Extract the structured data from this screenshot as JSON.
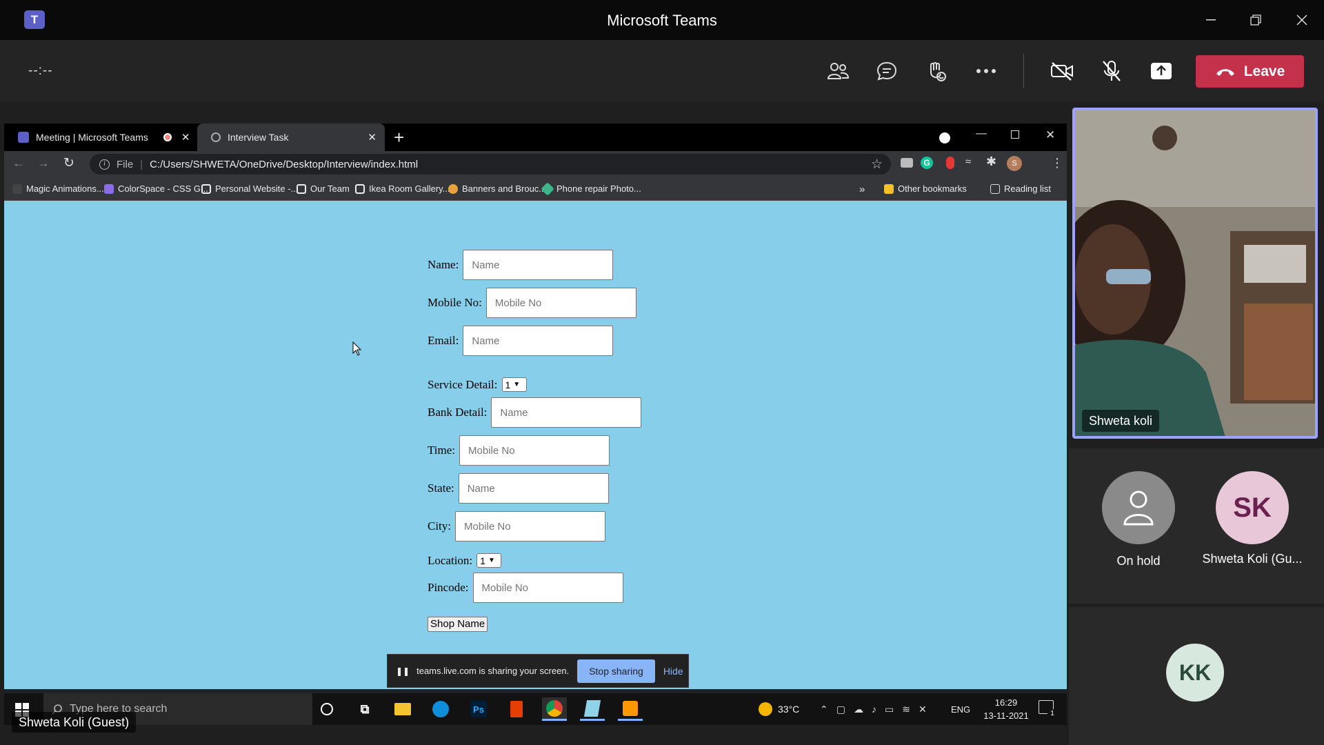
{
  "window": {
    "title": "Microsoft Teams",
    "app_icon": "teams-logo-icon"
  },
  "toolbar": {
    "timer": "--:--",
    "icons": [
      "people-icon",
      "chat-icon",
      "react-icon",
      "more-icon",
      "camera-off-icon",
      "mic-off-icon",
      "share-icon"
    ],
    "leave_label": "Leave",
    "leave_color": "#c4314b"
  },
  "browser": {
    "tabs": [
      {
        "label": "Meeting | Microsoft Teams",
        "active": false,
        "recording": true
      },
      {
        "label": "Interview Task",
        "active": true
      }
    ],
    "url_scheme": "File",
    "url": "C:/Users/SHWETA/OneDrive/Desktop/Interview/index.html",
    "bookmarks": [
      "Magic Animations...",
      "ColorSpace - CSS G...",
      "Personal Website -...",
      "Our Team",
      "Ikea Room Gallery...",
      "Banners and Brouc...",
      "Phone repair Photo..."
    ],
    "bookmarks_overflow": "»",
    "other_bookmarks": "Other bookmarks",
    "reading_list": "Reading list",
    "profile_initial": "S"
  },
  "form": {
    "bg_color": "#87ceeb",
    "fields": [
      {
        "label": "Name:",
        "type": "input",
        "placeholder": "Name"
      },
      {
        "label": "Mobile No:",
        "type": "input",
        "placeholder": "Mobile No"
      },
      {
        "label": "Email:",
        "type": "input",
        "placeholder": "Name"
      },
      {
        "label": "Service Detail:",
        "type": "select",
        "value": "1"
      },
      {
        "label": "Bank Detail:",
        "type": "input",
        "placeholder": "Name"
      },
      {
        "label": "Time:",
        "type": "input",
        "placeholder": "Mobile No"
      },
      {
        "label": "State:",
        "type": "input",
        "placeholder": "Name"
      },
      {
        "label": "City:",
        "type": "input",
        "placeholder": "Mobile No"
      },
      {
        "label": "Location:",
        "type": "select",
        "value": "1"
      },
      {
        "label": "Pincode:",
        "type": "input",
        "placeholder": "Mobile No"
      }
    ],
    "submit_label": "Shop Name"
  },
  "sharebar": {
    "message": "teams.live.com is sharing your screen.",
    "stop_label": "Stop sharing",
    "hide_label": "Hide"
  },
  "taskbar": {
    "search_placeholder": "Type here to search",
    "weather": "33°C",
    "language": "ENG",
    "time": "16:29",
    "date": "13-11-2021",
    "notification_count": "1"
  },
  "presenter_label": "Shweta Koli (Guest)",
  "participants": {
    "video": {
      "name": "Shweta koli"
    },
    "tiles": [
      {
        "initials": "",
        "name": "On hold",
        "avatar_color": "#8a8a8a"
      },
      {
        "initials": "SK",
        "name": "Shweta Koli (Gu...",
        "avatar_color": "#e8c7d8"
      },
      {
        "initials": "KK",
        "name": "",
        "avatar_color": "#d7e8df"
      }
    ]
  }
}
